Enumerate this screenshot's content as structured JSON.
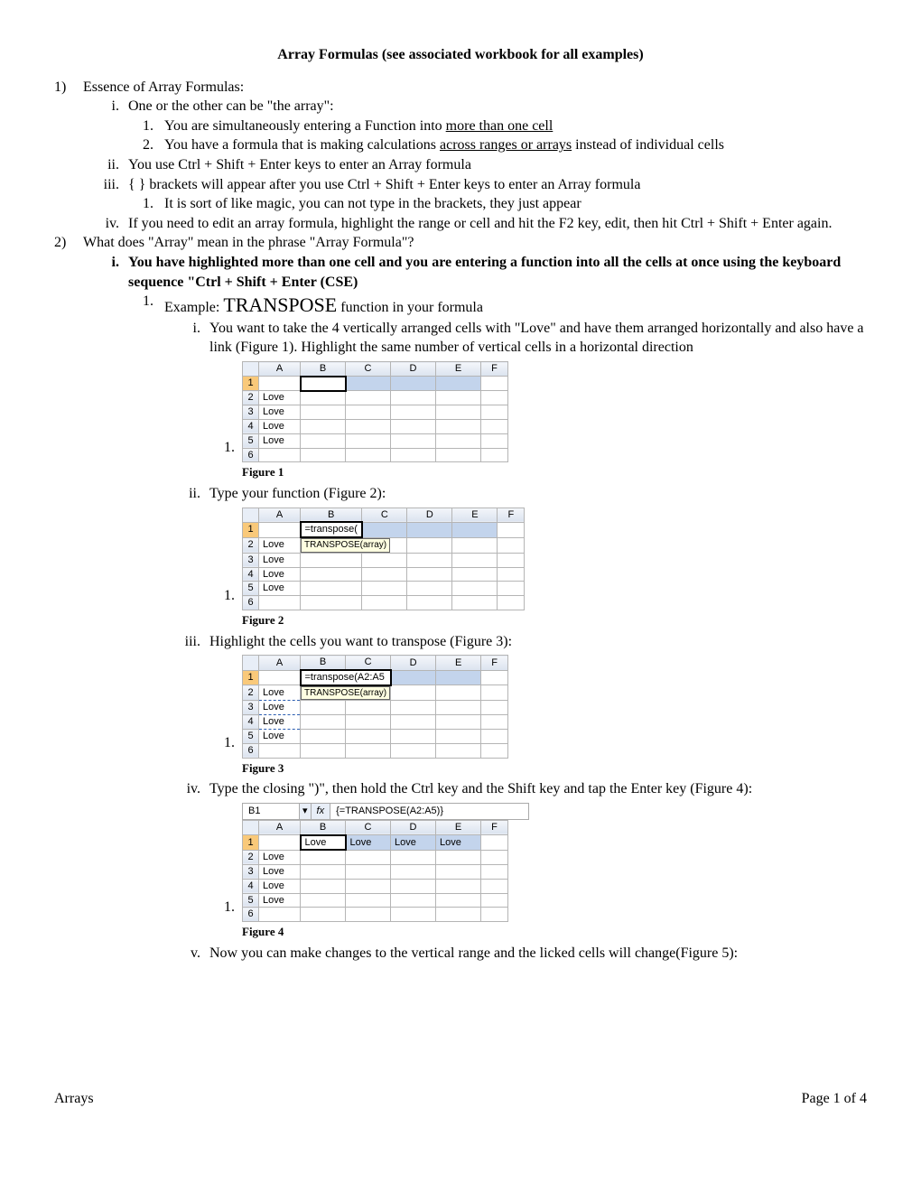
{
  "title": "Array Formulas (see associated workbook for all examples)",
  "s1": {
    "num": "1)",
    "text": "Essence of Array Formulas:",
    "i": {
      "num": "i.",
      "text": "One or the other can be \"the array\":"
    },
    "i1": {
      "num": "1.",
      "pre": "You are simultaneously entering a Function into ",
      "u": "more than one cell"
    },
    "i2": {
      "num": "2.",
      "pre": "You have a formula that is making calculations ",
      "u": "across ranges or arrays",
      "post": " instead of individual cells"
    },
    "ii": {
      "num": "ii.",
      "text": "You use Ctrl + Shift + Enter keys to enter an Array formula"
    },
    "iii": {
      "num": "iii.",
      "text": "{ } brackets will appear after you use Ctrl + Shift + Enter keys to enter an Array formula"
    },
    "iii1": {
      "num": "1.",
      "text": "It is sort of like magic, you can not type in the brackets, they just appear"
    },
    "iv": {
      "num": "iv.",
      "text": "If you need to edit an array formula, highlight the range or cell and hit the F2 key, edit, then hit Ctrl + Shift + Enter again."
    }
  },
  "s2": {
    "num": "2)",
    "text": "What does \"Array\" mean in the phrase \"Array Formula\"?",
    "i": {
      "num": "i.",
      "text": "You have highlighted more than one cell and you are entering a function into all the cells at once using the keyboard sequence \"Ctrl + Shift + Enter (CSE)"
    },
    "i1": {
      "num": "1.",
      "pre": "Example: ",
      "big": "TRANSPOSE",
      "post": " function in your formula"
    },
    "sub_i": {
      "num": "i.",
      "text": "You want to take the 4 vertically arranged cells with \"Love\" and have them arranged horizontally and also have a link (Figure 1). Highlight the same number of vertical cells in a horizontal direction"
    },
    "sub_ii": {
      "num": "ii.",
      "text": "Type your function (Figure 2):"
    },
    "sub_iii": {
      "num": "iii.",
      "text": "Highlight  the cells you want to transpose (Figure 3):"
    },
    "sub_iv": {
      "num": "iv.",
      "text": "Type the closing \")\", then hold the Ctrl key and the Shift key and tap the Enter key (Figure 4):"
    },
    "sub_v": {
      "num": "v.",
      "text": "Now you can make changes to the vertical range and the licked cells will change(Figure 5):"
    }
  },
  "figs": {
    "marker": "1.",
    "f1": "Figure 1",
    "f2": "Figure 2",
    "f3": "Figure 3",
    "f4": "Figure 4",
    "cols": [
      "A",
      "B",
      "C",
      "D",
      "E",
      "F"
    ],
    "rows": [
      "1",
      "2",
      "3",
      "4",
      "5",
      "6"
    ],
    "love": "Love",
    "typed2": "=transpose(",
    "tooltip2": "TRANSPOSE(array)",
    "typed3": "=transpose(A2:A5",
    "tooltip3": "TRANSPOSE(array)",
    "fb_name": "B1",
    "fb_fx": "fx",
    "fb_formula": "{=TRANSPOSE(A2:A5)}"
  },
  "footer": {
    "left": "Arrays",
    "right": "Page 1 of 4"
  }
}
